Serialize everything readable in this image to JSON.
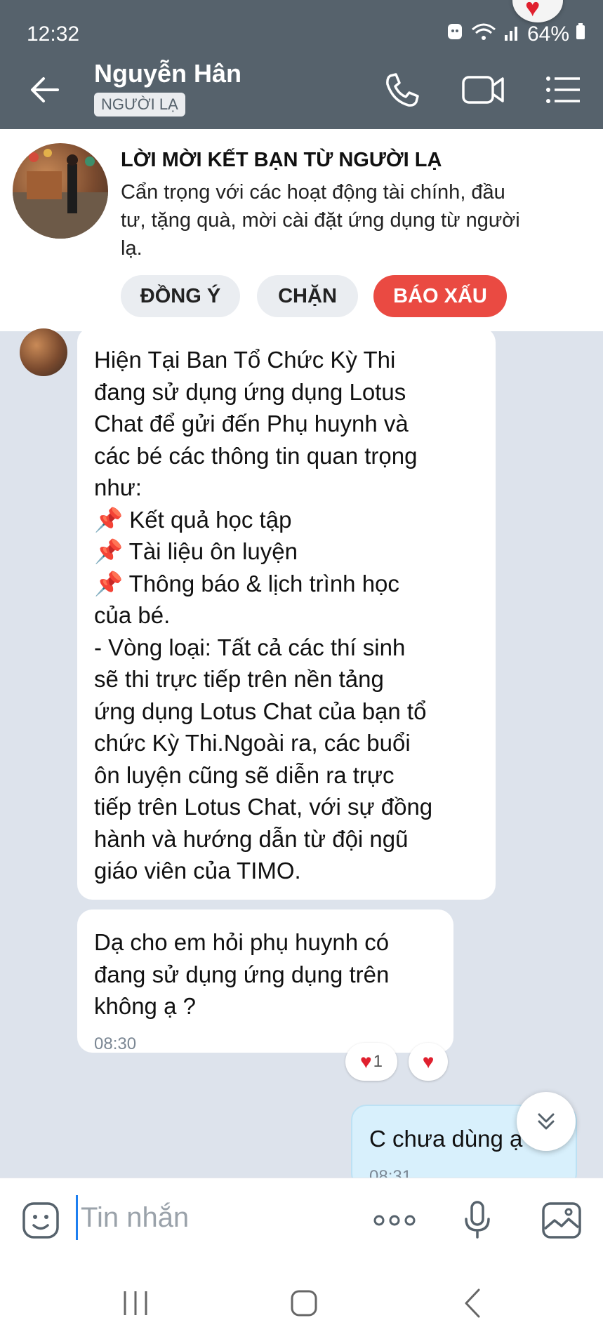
{
  "status_bar": {
    "time": "12:32",
    "battery": "64%"
  },
  "header": {
    "contact_name": "Nguyễn Hân",
    "badge": "NGƯỜI LẠ"
  },
  "warning": {
    "title": "LỜI MỜI KẾT BẠN TỪ NGƯỜI LẠ",
    "body_lines": [
      "Cẩn trọng với các hoạt động tài chính, đầu",
      "tư, tặng quà, mời cài đặt ứng dụng từ người",
      "lạ."
    ],
    "accept_label": "ĐỒNG Ý",
    "block_label": "CHẶN",
    "report_label": "BÁO XẤU"
  },
  "messages": [
    {
      "sender": "contact",
      "lines": [
        "Hiện Tại Ban Tổ Chức Kỳ Thi",
        "đang sử dụng ứng dụng Lotus",
        "Chat để gửi đến Phụ huynh và",
        "các bé các thông tin quan trọng",
        "như:",
        "📌 Kết quả học tập",
        "📌 Tài liệu ôn luyện",
        "📌 Thông báo & lịch trình học",
        "của bé.",
        "- Vòng loại: Tất cả các thí sinh",
        "sẽ thi trực tiếp trên nền tảng",
        "ứng dụng Lotus Chat của bạn tổ",
        "chức Kỳ Thi.Ngoài ra, các buổi",
        "ôn luyện cũng sẽ diễn ra trực",
        "tiếp trên Lotus Chat, với sự đồng",
        "hành và hướng dẫn từ đội ngũ",
        "giáo viên của TIMO."
      ]
    },
    {
      "sender": "contact",
      "lines": [
        "Dạ cho em hỏi phụ huynh có",
        "đang sử dụng ứng dụng trên",
        "không ạ ?"
      ],
      "time": "08:30",
      "reaction_count": "1"
    },
    {
      "sender": "me",
      "lines": [
        "C chưa dùng ạ"
      ],
      "time": "08:31"
    }
  ],
  "composer": {
    "placeholder": "Tin nhắn"
  },
  "icons": {
    "back": "arrow-left-icon",
    "call": "phone-icon",
    "video": "video-camera-icon",
    "menu": "menu-icon",
    "emoji": "emoji-icon",
    "more": "more-dots-icon",
    "mic": "microphone-icon",
    "gallery": "image-icon"
  },
  "colors": {
    "header_bg": "#56626c",
    "report": "#ea4a42",
    "my_bubble": "#d8f0fc",
    "chat_bg": "#dde3ec"
  }
}
